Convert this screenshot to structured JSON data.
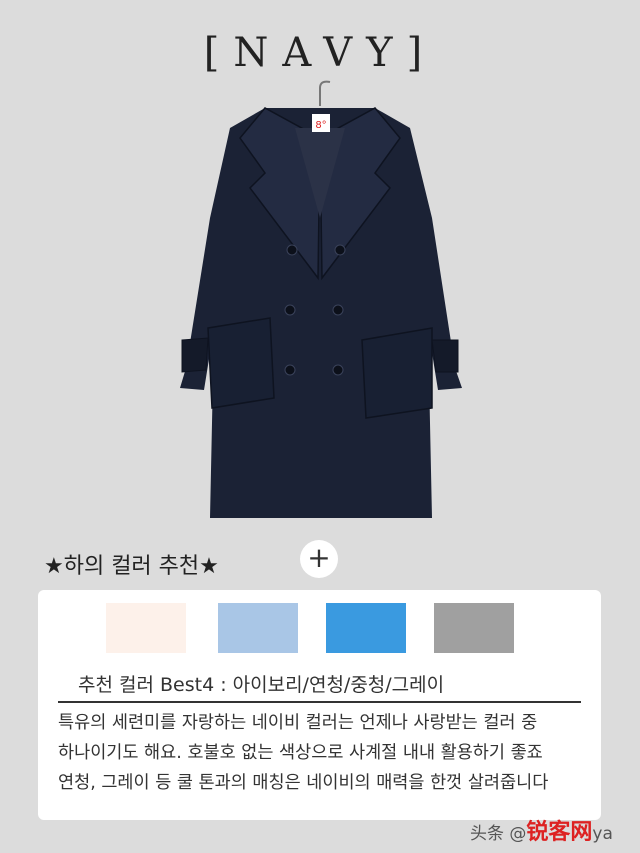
{
  "title": "[NAVY]",
  "subtitle": "★하의 컬러 추천★",
  "plus_symbol": "+",
  "swatches": [
    {
      "name": "아이보리",
      "color": "#fdf1ea"
    },
    {
      "name": "연청",
      "color": "#a9c6e6"
    },
    {
      "name": "중청",
      "color": "#3a9ae0"
    },
    {
      "name": "그레이",
      "color": "#a0a0a0"
    }
  ],
  "recommend_line": "추천 컬러 Best4 : 아이보리/연청/중청/그레이",
  "description": [
    "특유의 세련미를 자랑하는 네이비 컬러는 언제나 사랑받는 컬러 중",
    "하나이기도 해요. 호불호 없는 색상으로 사계절 내내 활용하기 좋죠",
    "연청, 그레이 등 쿨 톤과의 매칭은 네이비의 매력을 한껏 살려줍니다"
  ],
  "coat_tag": "8°",
  "coat_color": "#1b2235",
  "watermark_prefix": "头条 @",
  "watermark_brand": "锐客网",
  "watermark_suffix": "ya"
}
